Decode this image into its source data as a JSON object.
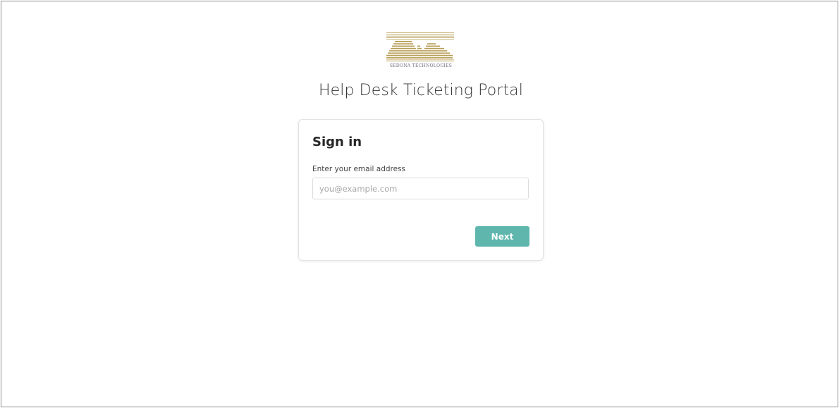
{
  "brand": {
    "logo_caption": "SEDONA TECHNOLOGIES",
    "logo_icon": "sedona-mesa-logo",
    "logo_color": "#b8a05a"
  },
  "portal_title": "Help Desk Ticketing Portal",
  "signin_card": {
    "title": "Sign in",
    "email_label": "Enter your email address",
    "email_value": "",
    "email_placeholder": "you@example.com",
    "next_label": "Next"
  },
  "colors": {
    "accent": "#5fb6ad",
    "card_border": "#e2e2e2"
  }
}
